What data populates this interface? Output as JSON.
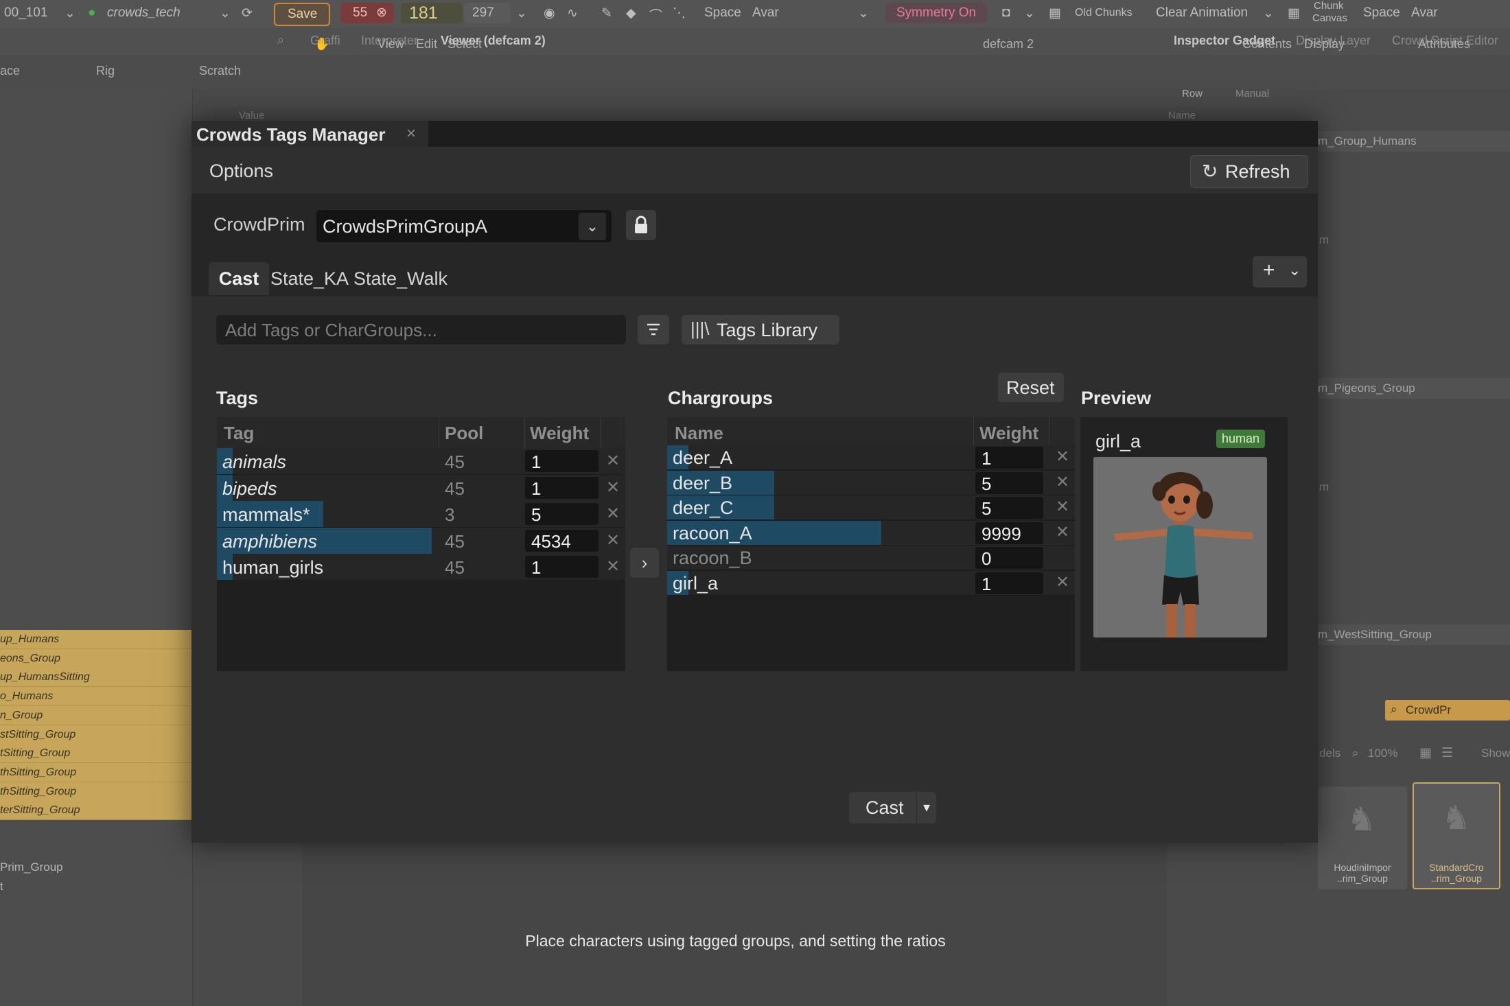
{
  "topbar": {
    "layer_field": "00_101",
    "workspace": "crowds_tech",
    "save_label": "Save",
    "error_count": "55",
    "frame_current": "181",
    "frame_end": "297",
    "space_label": "Space",
    "avar_label": "Avar",
    "symmetry_label": "Symmetry On",
    "old_chunks_label": "Old Chunks",
    "clear_animation_label": "Clear Animation",
    "chunk_canvas_label_1": "Chunk",
    "chunk_canvas_label_2": "Canvas",
    "space_label_2": "Space",
    "avar_label_2": "Avar"
  },
  "secondbar": {
    "tabs": [
      "Graffi",
      "Interpreter",
      "Viewer (defcam 2)"
    ],
    "right_tabs": [
      "Inspector Gadget",
      "Display Layer",
      "Crowd Script Editor"
    ]
  },
  "thirdbar": {
    "left_tabs": [
      "ace",
      "Rig",
      "Scratch"
    ],
    "menu": [
      "View",
      "Edit",
      "Select"
    ],
    "camera_label": "defcam 2",
    "right_menu": [
      "Contents",
      "Display",
      "Attributes"
    ],
    "row_label": "Row",
    "manual_label": "Manual",
    "value_label": "Value",
    "name_label": "Name"
  },
  "outliner": {
    "items": [
      "up_Humans",
      "eons_Group",
      "up_HumansSitting",
      "o_Humans",
      "n_Group",
      "stSitting_Group",
      "tSitting_Group",
      "thSitting_Group",
      "thSitting_Group",
      "terSitting_Group"
    ],
    "below": [
      "Prim_Group",
      "t"
    ]
  },
  "right_panel": {
    "groups": [
      "m_Group_Humans",
      "m_Pigeons_Group",
      "m_WestSitting_Group"
    ],
    "letters": [
      "m",
      "m"
    ],
    "search_label": "CrowdPr",
    "zoom_label": "100%",
    "dels_label": "dels",
    "show_label": "Show",
    "thumb1_label": "HoudiniImpor ..rim_Group",
    "thumb2_label": "StandardCro ..rim_Group"
  },
  "dialog": {
    "title": "Crowds Tags Manager",
    "close_glyph": "×",
    "options_label": "Options",
    "refresh_label": "Refresh",
    "crowdprim_label": "CrowdPrim",
    "crowdprim_value": "CrowdsPrimGroupA",
    "tabs": [
      "Cast",
      "State_KA",
      "State_Walk"
    ],
    "add_placeholder": "Add Tags or CharGroups...",
    "tags_library_label": "Tags Library",
    "tags_title": "Tags",
    "chargroups_title": "Chargroups",
    "reset_label": "Reset",
    "preview_title": "Preview",
    "cast_label": "Cast"
  },
  "tags_table": {
    "columns": [
      "Tag",
      "Pool",
      "Weight"
    ],
    "rows": [
      {
        "tag": "animals",
        "pool": "45",
        "weight": "1",
        "italic": true,
        "fill": 0.07
      },
      {
        "tag": "bipeds",
        "pool": "45",
        "weight": "1",
        "italic": true,
        "fill": 0.07
      },
      {
        "tag": "mammals*",
        "pool": "3",
        "weight": "5",
        "italic": false,
        "fill": 0.48
      },
      {
        "tag": "amphibiens",
        "pool": "45",
        "weight": "4534",
        "italic": true,
        "fill": 0.97
      },
      {
        "tag": "human_girls",
        "pool": "45",
        "weight": "1",
        "italic": false,
        "fill": 0.07
      }
    ]
  },
  "chargroups_table": {
    "columns": [
      "Name",
      "Weight"
    ],
    "rows": [
      {
        "name": "deer_A",
        "weight": "1",
        "fill": 0.07,
        "enabled": true
      },
      {
        "name": "deer_B",
        "weight": "5",
        "fill": 0.35,
        "enabled": true
      },
      {
        "name": "deer_C",
        "weight": "5",
        "fill": 0.35,
        "enabled": true
      },
      {
        "name": "racoon_A",
        "weight": "9999",
        "fill": 0.7,
        "enabled": true
      },
      {
        "name": "racoon_B",
        "weight": "0",
        "fill": 0,
        "enabled": false
      },
      {
        "name": "girl_a",
        "weight": "1",
        "fill": 0.07,
        "enabled": true
      }
    ]
  },
  "preview": {
    "name": "girl_a",
    "badge": "human"
  },
  "caption": "Place characters using tagged groups, and setting the ratios",
  "colors": {
    "tag_bar": "#1e4a63",
    "badge": "#3f7a3a",
    "outliner_row": "#c6a65a",
    "symmetry": "#e0436a"
  }
}
